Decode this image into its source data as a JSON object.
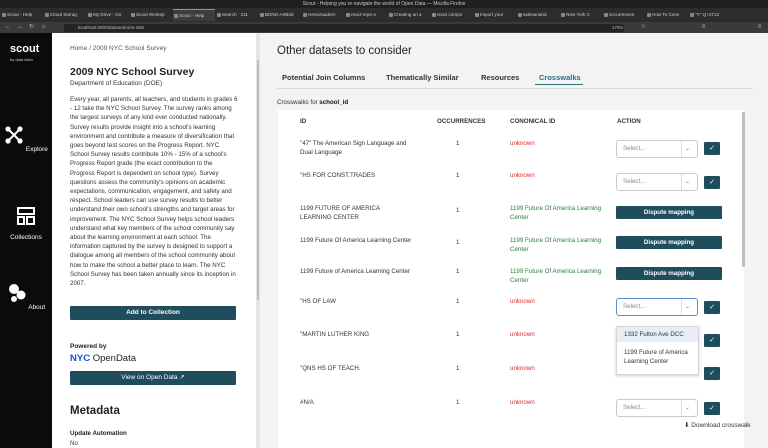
{
  "browser": {
    "window_title": "Scout - Helping you re-navigate the world of Open Data — Mozilla Firefox",
    "tabs": [
      "Scout - Help",
      "Cloud Storag",
      "My Drive - Go",
      "Scout Worksp",
      "Scout - Help",
      "Search · 211",
      "BDND-ArtBrid",
      "Henezaadern",
      "react-repo-s",
      "Creating an a",
      "react compo",
      "Import your",
      "salesanand",
      "New York C",
      "occurrences",
      "How To Conv",
      "\"Y\" Q+2713"
    ],
    "active_tab_index": 4,
    "url": "localhost:3000/dataset/ruhs-rs5s",
    "zoom": "170%"
  },
  "sidenav": {
    "brand": "scout",
    "brand_sub": "by data clinic",
    "items": [
      {
        "label": "Explore",
        "icon": "explore-icon"
      },
      {
        "label": "Collections",
        "icon": "collections-icon"
      },
      {
        "label": "About",
        "icon": "about-icon"
      }
    ]
  },
  "left": {
    "breadcrumb_home": "Home",
    "breadcrumb_sep": " / ",
    "breadcrumb_current": "2009 NYC School Survey",
    "title": "2009 NYC School Survey",
    "department": "Department of Education (DOE)",
    "description": "Every year, all parents, all teachers, and students in grades 6 - 12 take the NYC School Survey. The survey ranks among the largest surveys of any kind ever conducted nationally. Survey results provide insight into a school's learning environment and contribute a measure of diversification that goes beyond test scores on the Progress Report. NYC School Survey results contribute 10% - 15% of a school's Progress Report grade (the exact contribution to the Progress Report is dependent on school type). Survey questions assess the community's opinions on academic expectations, communication, engagement, and safety and respect. School leaders can use survey results to better understand their own school's strengths and target areas for improvement. The NYC School Survey helps school leaders understand what key members of the school community say about the learning environment at each school. The information captured by the survey is designed to support a dialogue among all members of the school community about how to make the school a better place to learn. The NYC School Survey has been taken annually since its inception in 2007.",
    "add_to_collection": "Add to Collection",
    "powered_by": "Powered by",
    "logo_nyc": "NYC",
    "logo_opendata": "OpenData",
    "view_open_data": "View on Open Data",
    "metadata_title": "Metadata",
    "metadata_key": "Update Automation",
    "metadata_value": "No"
  },
  "right": {
    "title": "Other datasets to consider",
    "tabs": [
      "Potential Join Columns",
      "Thematically Similar",
      "Resources",
      "Crosswalks"
    ],
    "active_tab": "Crosswalks",
    "crosswalks_prefix": "Crosswalks for ",
    "crosswalks_column": "school_id",
    "headers": {
      "id": "ID",
      "occurrences": "OCCURRENCES",
      "cononical": "CONONICAL ID",
      "action": "ACTION"
    },
    "select_placeholder": "Select...",
    "dispute_label": "Dispute mapping",
    "rows": [
      {
        "id": "\"47\" The American Sign Language and Dual Language",
        "occ": "1",
        "canon": "unknown",
        "status": "unknown",
        "action": "select"
      },
      {
        "id": "\"HS FOR CONST.TRADES",
        "occ": "1",
        "canon": "unknown",
        "status": "unknown",
        "action": "select"
      },
      {
        "id": "1199 FUTURE OF AMERICA LEARNING CENTER",
        "occ": "1",
        "canon": "1199 Future Of America Learning Center",
        "status": "mapped",
        "action": "dispute"
      },
      {
        "id": "1199 Future Of America Learning Center",
        "occ": "1",
        "canon": "1199 Future Of America Learning Center",
        "status": "mapped",
        "action": "dispute"
      },
      {
        "id": "1199 Future of America Learning Center",
        "occ": "1",
        "canon": "1199 Future Of America Learning Center",
        "status": "mapped",
        "action": "dispute"
      },
      {
        "id": "\"HS OF LAW",
        "occ": "1",
        "canon": "unknown",
        "status": "unknown",
        "action": "select-open"
      },
      {
        "id": "\"MARTIN LUTHER KING",
        "occ": "1",
        "canon": "unknown",
        "status": "unknown",
        "action": "select"
      },
      {
        "id": "\"QNS HS OF TEACH.",
        "occ": "1",
        "canon": "unknown",
        "status": "unknown",
        "action": "select"
      },
      {
        "id": "#N/A",
        "occ": "1",
        "canon": "unknown",
        "status": "unknown",
        "action": "select"
      }
    ],
    "dropdown_options": [
      "1332 Fulton Ave DCC",
      "1199 Future of America Learning Center"
    ],
    "download": "Download crosswalk",
    "colors": {
      "accent": "#1f4d5c",
      "unknown": "#d32f2f",
      "mapped": "#2e7d32",
      "active_tab": "#2a6f7f"
    }
  }
}
